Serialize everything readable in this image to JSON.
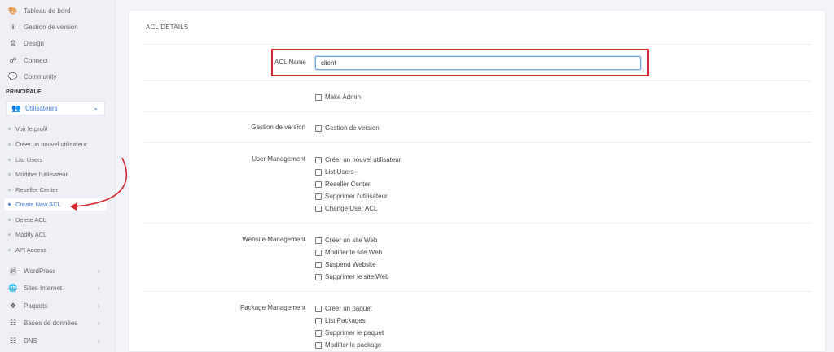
{
  "sidebar": {
    "top_items": [
      {
        "label": "Tableau de bord",
        "icon": "palette-icon"
      },
      {
        "label": "Gestion de version",
        "icon": "info-icon"
      },
      {
        "label": "Design",
        "icon": "gear-icon"
      },
      {
        "label": "Connect",
        "icon": "link-icon"
      },
      {
        "label": "Community",
        "icon": "chat-icon"
      }
    ],
    "section_label": "PRINCIPALE",
    "group": {
      "label": "Utilisateurs",
      "icon": "users-icon"
    },
    "sub_items": [
      {
        "label": "Voir le profil"
      },
      {
        "label": "Créer un nouvel utilisateur"
      },
      {
        "label": "List Users"
      },
      {
        "label": "Modifier l'utilisateur"
      },
      {
        "label": "Reseller Center"
      },
      {
        "label": "Create New ACL",
        "active": true
      },
      {
        "label": "Delete ACL"
      },
      {
        "label": "Modify ACL"
      },
      {
        "label": "API Access"
      }
    ],
    "bottom_items": [
      {
        "label": "WordPress",
        "icon": "wordpress-icon"
      },
      {
        "label": "Sites Internet",
        "icon": "globe-icon"
      },
      {
        "label": "Paquets",
        "icon": "packages-icon"
      },
      {
        "label": "Bases de données",
        "icon": "database-icon"
      },
      {
        "label": "DNS",
        "icon": "sitemap-icon"
      }
    ]
  },
  "panel": {
    "title": "ACL DETAILS",
    "acl_name_label": "ACL Name",
    "acl_name_value": "client",
    "sections": [
      {
        "label": "",
        "options": [
          "Make Admin"
        ]
      },
      {
        "label": "Gestion de version",
        "options": [
          "Gestion de version"
        ]
      },
      {
        "label": "User Management",
        "options": [
          "Créer un nouvel utilisateur",
          "List Users",
          "Reseller Center",
          "Supprimer l'utilisateur",
          "Change User ACL"
        ]
      },
      {
        "label": "Website Management",
        "options": [
          "Créer un site Web",
          "Modifier le site Web",
          "Suspend Website",
          "Supprimer le site Web"
        ]
      },
      {
        "label": "Package Management",
        "options": [
          "Créer un paquet",
          "List Packages",
          "Supprimer le paquet",
          "Modifier le package"
        ]
      }
    ]
  },
  "colors": {
    "accent": "#3a7bd5",
    "highlight": "#d9262e"
  }
}
